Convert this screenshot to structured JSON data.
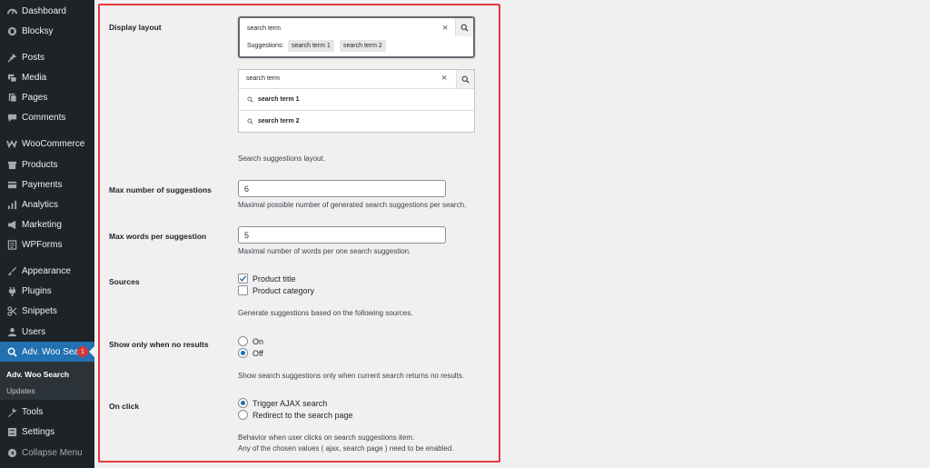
{
  "sidebar": {
    "items": [
      {
        "label": "Dashboard",
        "icon": "dashboard-icon"
      },
      {
        "label": "Blocksy",
        "icon": "blocksy-icon"
      },
      {
        "label": "Posts",
        "icon": "pushpin-icon"
      },
      {
        "label": "Media",
        "icon": "media-icon"
      },
      {
        "label": "Pages",
        "icon": "pages-icon"
      },
      {
        "label": "Comments",
        "icon": "comments-icon"
      },
      {
        "label": "WooCommerce",
        "icon": "woocommerce-icon"
      },
      {
        "label": "Products",
        "icon": "products-icon"
      },
      {
        "label": "Payments",
        "icon": "payments-icon"
      },
      {
        "label": "Analytics",
        "icon": "analytics-icon"
      },
      {
        "label": "Marketing",
        "icon": "megaphone-icon"
      },
      {
        "label": "WPForms",
        "icon": "wpforms-icon"
      },
      {
        "label": "Appearance",
        "icon": "paintbrush-icon"
      },
      {
        "label": "Plugins",
        "icon": "plugin-icon"
      },
      {
        "label": "Snippets",
        "icon": "snippets-icon"
      },
      {
        "label": "Users",
        "icon": "users-icon"
      },
      {
        "label": "Adv. Woo Searc",
        "icon": "search-icon",
        "badge": "1"
      },
      {
        "label": "Tools",
        "icon": "wrench-icon"
      },
      {
        "label": "Settings",
        "icon": "settings-icon"
      },
      {
        "label": "Collapse Menu",
        "icon": "collapse-icon"
      }
    ],
    "submenu": [
      {
        "label": "Adv. Woo Search"
      },
      {
        "label": "Updates"
      }
    ]
  },
  "settings": {
    "display_layout": {
      "label": "Display layout",
      "preview1": {
        "input_value": "search term",
        "suggestions_label": "Suggestions:",
        "chips": [
          "search term 1",
          "search term 2"
        ]
      },
      "preview2": {
        "input_value": "search term",
        "rows": [
          "search term 1",
          "search term 2"
        ]
      },
      "description": "Search suggestions layout."
    },
    "max_suggestions": {
      "label": "Max number of suggestions",
      "value": "6",
      "description": "Maximal possible number of generated search suggestions per search."
    },
    "max_words": {
      "label": "Max words per suggestion",
      "value": "5",
      "description": "Maximal number of words per one search suggestion."
    },
    "sources": {
      "label": "Sources",
      "options": [
        {
          "label": "Product title",
          "checked": true
        },
        {
          "label": "Product category",
          "checked": false
        }
      ],
      "description": "Generate suggestions based on the following sources."
    },
    "show_only_no_results": {
      "label": "Show only when no results",
      "options": [
        {
          "label": "On",
          "selected": false
        },
        {
          "label": "Off",
          "selected": true
        }
      ],
      "description": "Show search suggestions only when current search returns no results."
    },
    "on_click": {
      "label": "On click",
      "options": [
        {
          "label": "Trigger AJAX search",
          "selected": true
        },
        {
          "label": "Redirect to the search page",
          "selected": false
        }
      ],
      "description_line1": "Behavior when user clicks on search suggestions item.",
      "description_line2": "Any of the chosen values ( ajax, search page ) need to be enabled."
    }
  },
  "colors": {
    "sidebar_bg": "#1d2327",
    "active_menu": "#2271b1",
    "highlight_border": "#e6393a",
    "badge": "#d63638"
  }
}
